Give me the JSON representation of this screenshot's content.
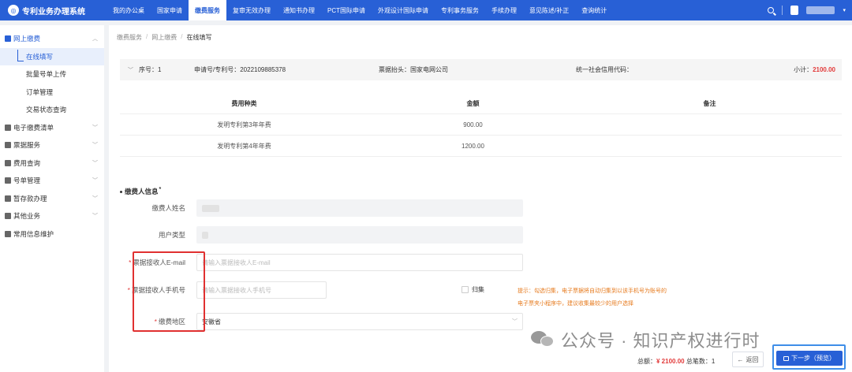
{
  "app": {
    "title": "专利业务办理系统"
  },
  "nav": {
    "items": [
      {
        "label": "我的办公桌"
      },
      {
        "label": "国家申请"
      },
      {
        "label": "缴费服务",
        "active": true
      },
      {
        "label": "复审无效办理"
      },
      {
        "label": "通知书办理"
      },
      {
        "label": "PCT国际申请"
      },
      {
        "label": "外观设计国际申请"
      },
      {
        "label": "专利事务服务"
      },
      {
        "label": "手续办理"
      },
      {
        "label": "意见陈述/补正"
      },
      {
        "label": "查询统计"
      }
    ]
  },
  "sidebar": {
    "group_online": "网上缴费",
    "sub_fill": "在线填写",
    "sub_batch": "批量号单上传",
    "sub_orders": "订单管理",
    "sub_tx": "交易状态查询",
    "group_list": "电子缴费清单",
    "group_invoice": "票据服务",
    "group_fee_query": "费用查询",
    "group_number": "号单管理",
    "group_deposit": "暂存款办理",
    "group_other": "其他业务",
    "group_common": "常用信息维护"
  },
  "breadcrumb": {
    "a": "缴费服务",
    "b": "网上缴费",
    "c": "在线填写"
  },
  "order": {
    "seq": "序号：1",
    "appno": "申请号/专利号：2022109885378",
    "invoice_title": "票据抬头：国家电网公司",
    "credit_code": "统一社会信用代码：",
    "subtotal_label": "小计：",
    "subtotal_value": "2100.00"
  },
  "fee_table": {
    "headers": [
      "费用种类",
      "金额",
      "备注"
    ],
    "rows": [
      {
        "type": "发明专利第3年年费",
        "amount": "900.00",
        "note": ""
      },
      {
        "type": "发明专利第4年年费",
        "amount": "1200.00",
        "note": ""
      }
    ]
  },
  "payer": {
    "section_title": "缴费人信息",
    "name_label": "缴费人姓名",
    "user_type_label": "用户类型",
    "email_label": "票据接收人E-mail",
    "email_placeholder": "请输入票据接收人E-mail",
    "phone_label": "票据接收人手机号",
    "phone_placeholder": "请输入票据接收人手机号",
    "archive_label": "归集",
    "region_label": "缴费地区",
    "region_value": "安徽省",
    "tip_line1": "提示：勾选归集，电子票据将自动归集到以该手机号为账号的",
    "tip_line2": "电子票夹小程序中，建议收集最较少的用户选择"
  },
  "footer": {
    "total_label": "总额：",
    "total_value": "¥ 2100.00",
    "count_label": "总笔数：",
    "count_value": "1",
    "back_label": "返回",
    "next_label": "下一步（预览）"
  },
  "watermark": {
    "text": "公众号 · 知识产权进行时"
  },
  "colors": {
    "primary": "#2860d6",
    "accent_red": "#e23b3b",
    "tip_orange": "#e67a1d",
    "highlight": "#e03030"
  }
}
